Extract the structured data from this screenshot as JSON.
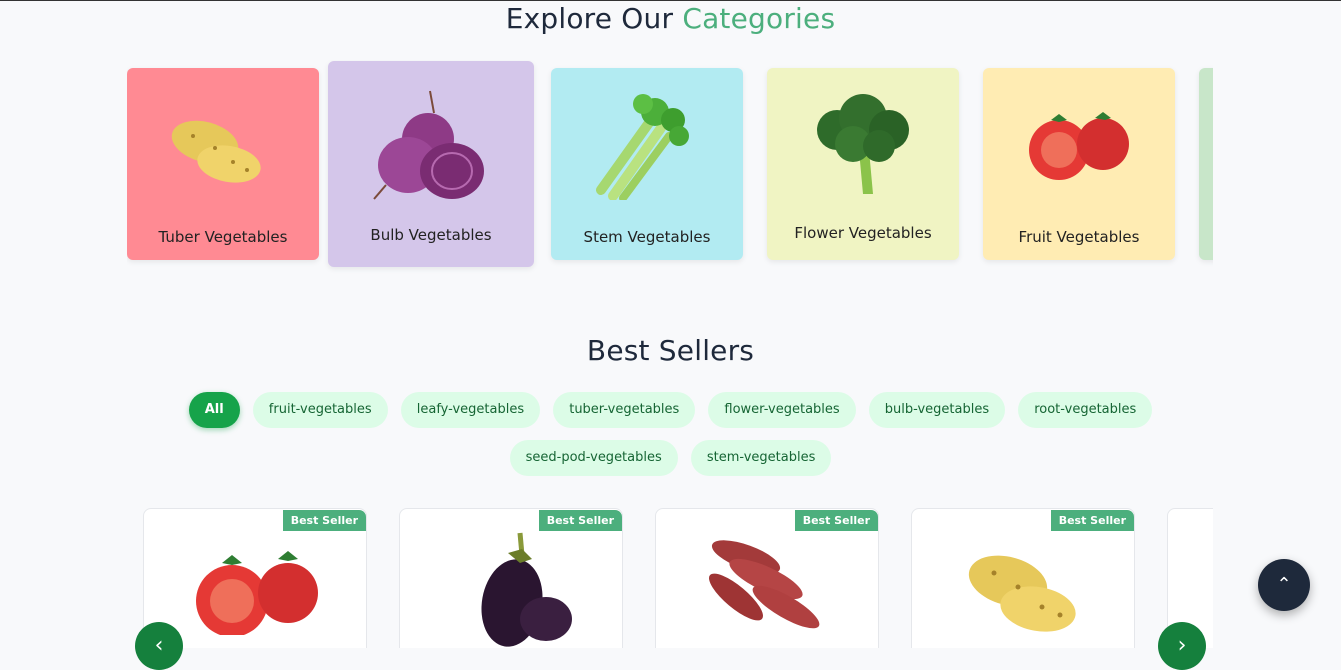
{
  "categories_section": {
    "title_prefix": "Explore Our",
    "title_accent": "Categories",
    "items": [
      {
        "label": "Tuber Vegetables",
        "color": "#ff8a93",
        "icon": "potato-icon"
      },
      {
        "label": "Bulb Vegetables",
        "color": "#d4c6ea",
        "icon": "onion-icon"
      },
      {
        "label": "Stem Vegetables",
        "color": "#b2ebf2",
        "icon": "celery-icon"
      },
      {
        "label": "Flower Vegetables",
        "color": "#f0f4c3",
        "icon": "broccoli-icon"
      },
      {
        "label": "Fruit Vegetables",
        "color": "#ffecb3",
        "icon": "tomato-icon"
      },
      {
        "label": "",
        "color": "#c8e6c9",
        "icon": ""
      }
    ]
  },
  "best_sellers": {
    "title": "Best Sellers",
    "filters": [
      "All",
      "fruit-vegetables",
      "leafy-vegetables",
      "tuber-vegetables",
      "flower-vegetables",
      "bulb-vegetables",
      "root-vegetables",
      "seed-pod-vegetables",
      "stem-vegetables"
    ],
    "products": [
      {
        "badge": "Best Seller",
        "icon": "tomato-icon"
      },
      {
        "badge": "Best Seller",
        "icon": "eggplant-icon"
      },
      {
        "badge": "Best Seller",
        "icon": "sweet-potato-icon"
      },
      {
        "badge": "Best Seller",
        "icon": "potato-icon"
      }
    ],
    "prev_icon": "‹",
    "next_icon": "›"
  },
  "scroll_top_icon": "⌃"
}
